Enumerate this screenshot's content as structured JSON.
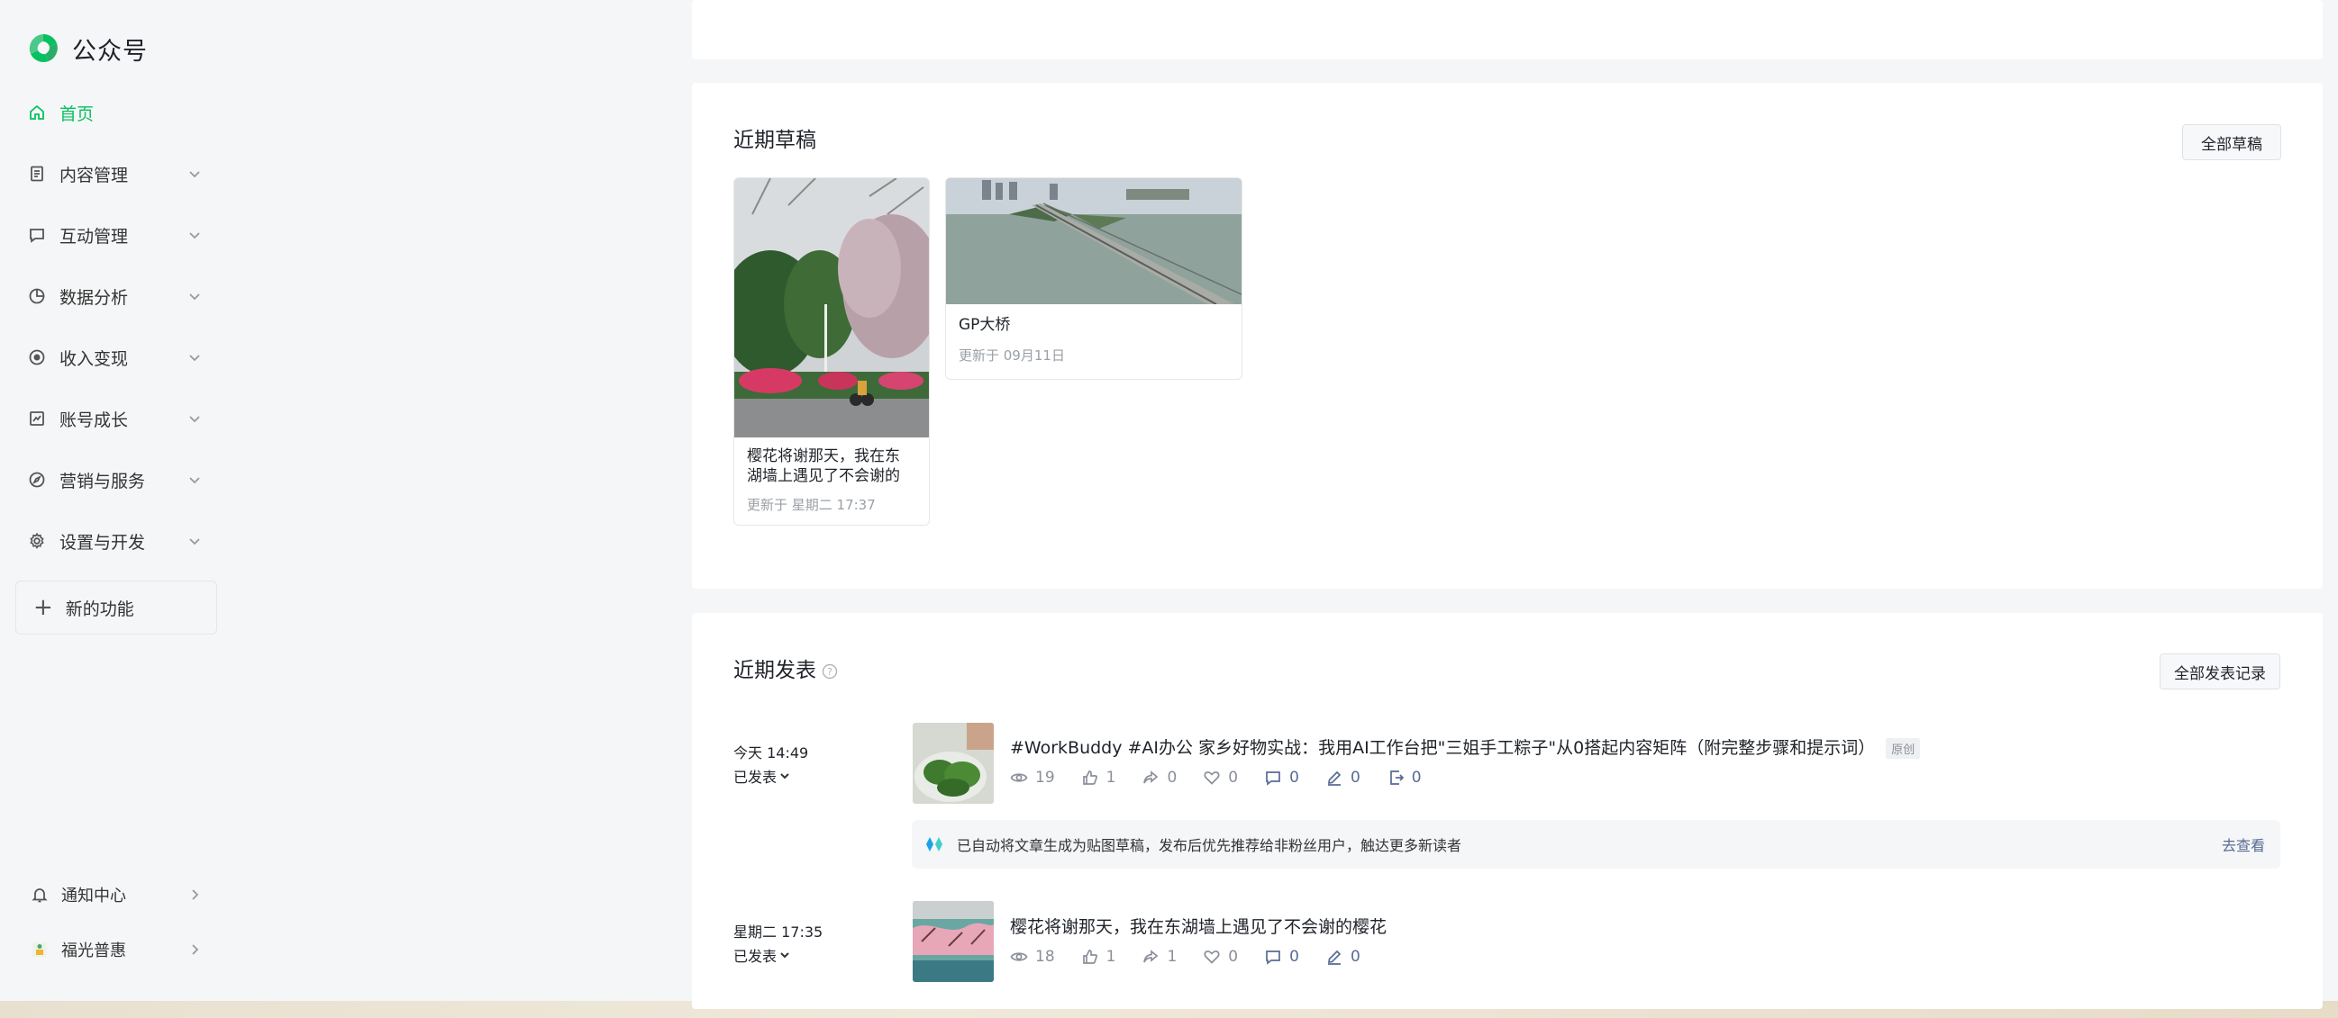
{
  "brand": {
    "name": "公众号",
    "logo_color": "#07c160"
  },
  "sidebar": {
    "items": [
      {
        "label": "首页",
        "icon": "home-icon",
        "active": true
      },
      {
        "label": "内容管理",
        "icon": "document-icon"
      },
      {
        "label": "互动管理",
        "icon": "comment-icon"
      },
      {
        "label": "数据分析",
        "icon": "pie-chart-icon"
      },
      {
        "label": "收入变现",
        "icon": "coin-icon"
      },
      {
        "label": "账号成长",
        "icon": "growth-chart-icon"
      },
      {
        "label": "营销与服务",
        "icon": "compass-icon"
      },
      {
        "label": "设置与开发",
        "icon": "gear-icon"
      }
    ],
    "new_feature_label": "新的功能",
    "bottom_items": [
      {
        "label": "通知中心",
        "icon": "bell-icon"
      },
      {
        "label": "福光普惠",
        "icon": "avatar-icon"
      }
    ]
  },
  "drafts": {
    "title": "近期草稿",
    "all_button": "全部草稿",
    "items": [
      {
        "title_line1": "樱花将谢那天，我在东",
        "title_line2": "湖墙上遇见了不会谢的",
        "updated": "更新于 星期二 17:37"
      },
      {
        "title_line1": "GP大桥",
        "updated": "更新于 09月11日"
      }
    ]
  },
  "published": {
    "title": "近期发表",
    "all_button": "全部发表记录",
    "items": [
      {
        "time": "今天 14:49",
        "status": "已发表",
        "title": "#WorkBuddy #AI办公 家乡好物实战：我用AI工作台把\"三姐手工粽子\"从0搭起内容矩阵（附完整步骤和提示词）",
        "badge": "原创",
        "stats": {
          "views": "19",
          "likes": "1",
          "shares": "0",
          "favorites": "0",
          "comments": "0",
          "notes": "0",
          "reposts": "0"
        }
      },
      {
        "time": "星期二 17:35",
        "status": "已发表",
        "title": "樱花将谢那天，我在东湖墙上遇见了不会谢的樱花",
        "stats": {
          "views": "18",
          "likes": "1",
          "shares": "1",
          "favorites": "0",
          "comments": "0",
          "notes": "0"
        }
      }
    ],
    "notice": {
      "text": "已自动将文章生成为贴图草稿，发布后优先推荐给非粉丝用户，触达更多新读者",
      "link": "去查看"
    }
  },
  "colors": {
    "accent": "#07c160",
    "link": "#576b95",
    "muted": "#8a8f99"
  }
}
